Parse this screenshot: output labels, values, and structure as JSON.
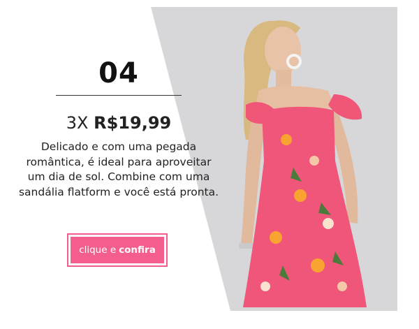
{
  "item": {
    "number": "04",
    "price_prefix": "3X",
    "price_value": "R$19,99",
    "description": "Delicado e com uma pegada romântica, é ideal para aproveitar um dia de sol. Combine com uma sandália flatform e você está pronta."
  },
  "cta": {
    "label_prefix": "clique e",
    "label_emphasis": "confira"
  },
  "colors": {
    "accent": "#f45e8c",
    "photo_background": "#d6d6d9",
    "dress": "#f05679"
  }
}
